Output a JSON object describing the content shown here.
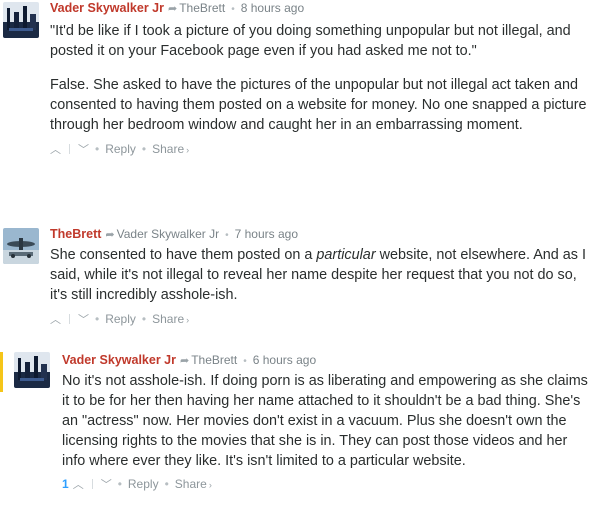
{
  "comments": [
    {
      "author": "Vader Skywalker Jr",
      "reply_to": "TheBrett",
      "time": "8 hours ago",
      "paragraphs": [
        "\"It'd be like if I took a picture of you doing something unpopular but not illegal, and posted it on your Facebook page even if you had asked me not to.\"",
        "False. She asked to have the pictures of the unpopular but not illegal act taken and consented to having them posted on a website for money. No one snapped a picture through her bedroom window and caught her in an embarrassing moment."
      ],
      "reply_label": "Reply",
      "share_label": "Share",
      "upvote_icon": "up-chevron-icon",
      "downvote_icon": "down-chevron-icon"
    },
    {
      "author": "TheBrett",
      "reply_to": "Vader Skywalker Jr",
      "time": "7 hours ago",
      "text_before_em": "She consented to have them posted on a ",
      "text_em": "particular",
      "text_after_em": " website, not elsewhere. And as I said, while it's not illegal to reveal her name despite her request that you not do so, it's still incredibly asshole-ish.",
      "reply_label": "Reply",
      "share_label": "Share"
    },
    {
      "author": "Vader Skywalker Jr",
      "reply_to": "TheBrett",
      "time": "6 hours ago",
      "paragraphs": [
        "No it's not asshole-ish. If doing porn is as liberating and empowering as she claims it to be for her then having her name attached to it shouldn't be a bad thing. She's an \"actress\" now. Her movies don't exist in a vacuum. Plus she doesn't own the licensing rights to the movies that she is in. They can post those videos and her info where ever they like. It's isn't limited to a particular website."
      ],
      "vote_count": "1",
      "reply_label": "Reply",
      "share_label": "Share"
    }
  ],
  "colors": {
    "author": "#c0392b",
    "accent": "#2e9fff",
    "highlight": "#f5c518"
  }
}
